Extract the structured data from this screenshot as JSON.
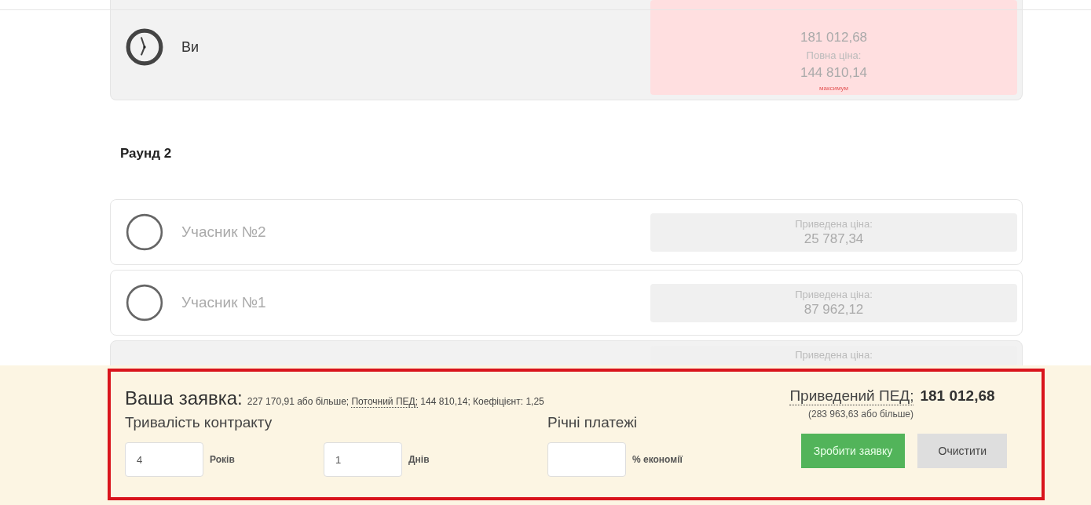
{
  "rounds": [
    {
      "bids": [
        {
          "kind": "you",
          "name": "Ви",
          "highlighted": true,
          "price_lines": [
            {
              "kind": "value",
              "text": "181 012,68"
            },
            {
              "kind": "label",
              "text": "Повна ціна:"
            },
            {
              "kind": "value",
              "text": "144 810,14"
            },
            {
              "kind": "note",
              "text": "максимум"
            }
          ]
        }
      ]
    },
    {
      "heading": "Раунд 2",
      "bids": [
        {
          "kind": "participant",
          "name": "Учасник №2",
          "highlighted": false,
          "price_lines": [
            {
              "kind": "label",
              "text": "Приведена ціна:"
            },
            {
              "kind": "value",
              "text": "25 787,34"
            }
          ]
        },
        {
          "kind": "participant",
          "name": "Учасник №1",
          "highlighted": false,
          "price_lines": [
            {
              "kind": "label",
              "text": "Приведена ціна:"
            },
            {
              "kind": "value",
              "text": "87 962,12"
            }
          ]
        },
        {
          "kind": "hidden",
          "highlighted": false,
          "price_lines": [
            {
              "kind": "label",
              "text": "Приведена ціна:"
            }
          ]
        }
      ]
    }
  ],
  "bid_panel": {
    "title": "Ваша заявка:",
    "summary_before": "227 170,91 або більше;",
    "summary_term": "Поточний ПЕД;",
    "summary_after": "144 810,14; Коефіцієнт: 1,25",
    "duration_label": "Тривалість контракту",
    "duration_fields": [
      {
        "value": "4",
        "unit": "Років"
      },
      {
        "value": "1",
        "unit": "Днів"
      }
    ],
    "payments_label": "Річні платежі",
    "payments_field": {
      "unit": "% економії"
    },
    "npv_term": "Приведений ПЕД;",
    "npv_value": "181 012,68",
    "npv_minimum": "(283 963,63 або більше)",
    "buttons": [
      {
        "kind": "primary",
        "label": "Зробити заявку"
      },
      {
        "kind": "secondary",
        "label": "Очистити"
      }
    ]
  }
}
